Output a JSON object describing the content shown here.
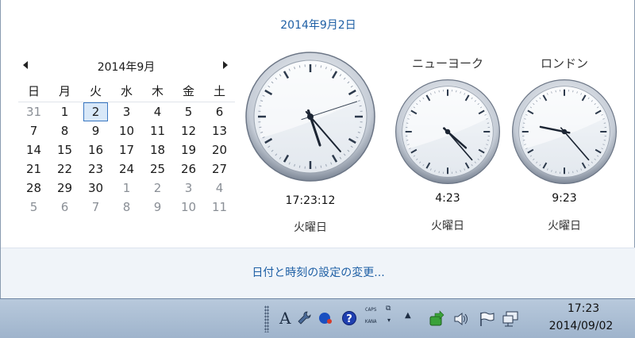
{
  "header": {
    "date_link": "2014年9月2日"
  },
  "calendar": {
    "month_title": "2014年9月",
    "weekdays": [
      "日",
      "月",
      "火",
      "水",
      "木",
      "金",
      "土"
    ],
    "weeks": [
      [
        {
          "d": "31",
          "o": true
        },
        {
          "d": "1"
        },
        {
          "d": "2",
          "today": true
        },
        {
          "d": "3"
        },
        {
          "d": "4"
        },
        {
          "d": "5"
        },
        {
          "d": "6"
        }
      ],
      [
        {
          "d": "7"
        },
        {
          "d": "8"
        },
        {
          "d": "9"
        },
        {
          "d": "10"
        },
        {
          "d": "11"
        },
        {
          "d": "12"
        },
        {
          "d": "13"
        }
      ],
      [
        {
          "d": "14"
        },
        {
          "d": "15"
        },
        {
          "d": "16"
        },
        {
          "d": "17"
        },
        {
          "d": "18"
        },
        {
          "d": "19"
        },
        {
          "d": "20"
        }
      ],
      [
        {
          "d": "21"
        },
        {
          "d": "22"
        },
        {
          "d": "23"
        },
        {
          "d": "24"
        },
        {
          "d": "25"
        },
        {
          "d": "26"
        },
        {
          "d": "27"
        }
      ],
      [
        {
          "d": "28"
        },
        {
          "d": "29"
        },
        {
          "d": "30"
        },
        {
          "d": "1",
          "o": true
        },
        {
          "d": "2",
          "o": true
        },
        {
          "d": "3",
          "o": true
        },
        {
          "d": "4",
          "o": true
        }
      ],
      [
        {
          "d": "5",
          "o": true
        },
        {
          "d": "6",
          "o": true
        },
        {
          "d": "7",
          "o": true
        },
        {
          "d": "8",
          "o": true
        },
        {
          "d": "9",
          "o": true
        },
        {
          "d": "10",
          "o": true
        },
        {
          "d": "11",
          "o": true
        }
      ]
    ]
  },
  "clocks": {
    "local": {
      "name": "",
      "time": "17:23:12",
      "day": "火曜日",
      "h": 17,
      "m": 23,
      "s": 12
    },
    "newyork": {
      "name": "ニューヨーク",
      "time": "4:23",
      "day": "火曜日",
      "h": 4,
      "m": 23,
      "s": 12
    },
    "london": {
      "name": "ロンドン",
      "time": "9:23",
      "day": "火曜日",
      "h": 9,
      "m": 23,
      "s": 12
    }
  },
  "settings": {
    "link": "日付と時刻の設定の変更..."
  },
  "taskbar": {
    "caps_label": "CAPS",
    "kana_label": "KANA",
    "ime_label": "A",
    "clock_time": "17:23",
    "clock_date": "2014/09/02",
    "icons": [
      "ime-mode-icon",
      "wrench-icon",
      "ime-dot-icon",
      "help-icon",
      "show-hidden-icon",
      "network-sync-icon",
      "volume-icon",
      "action-center-flag-icon",
      "network-icon"
    ]
  },
  "colors": {
    "link": "#1e5fa5",
    "taskbar": "#a9bdd3",
    "today_border": "#3a78c2"
  }
}
